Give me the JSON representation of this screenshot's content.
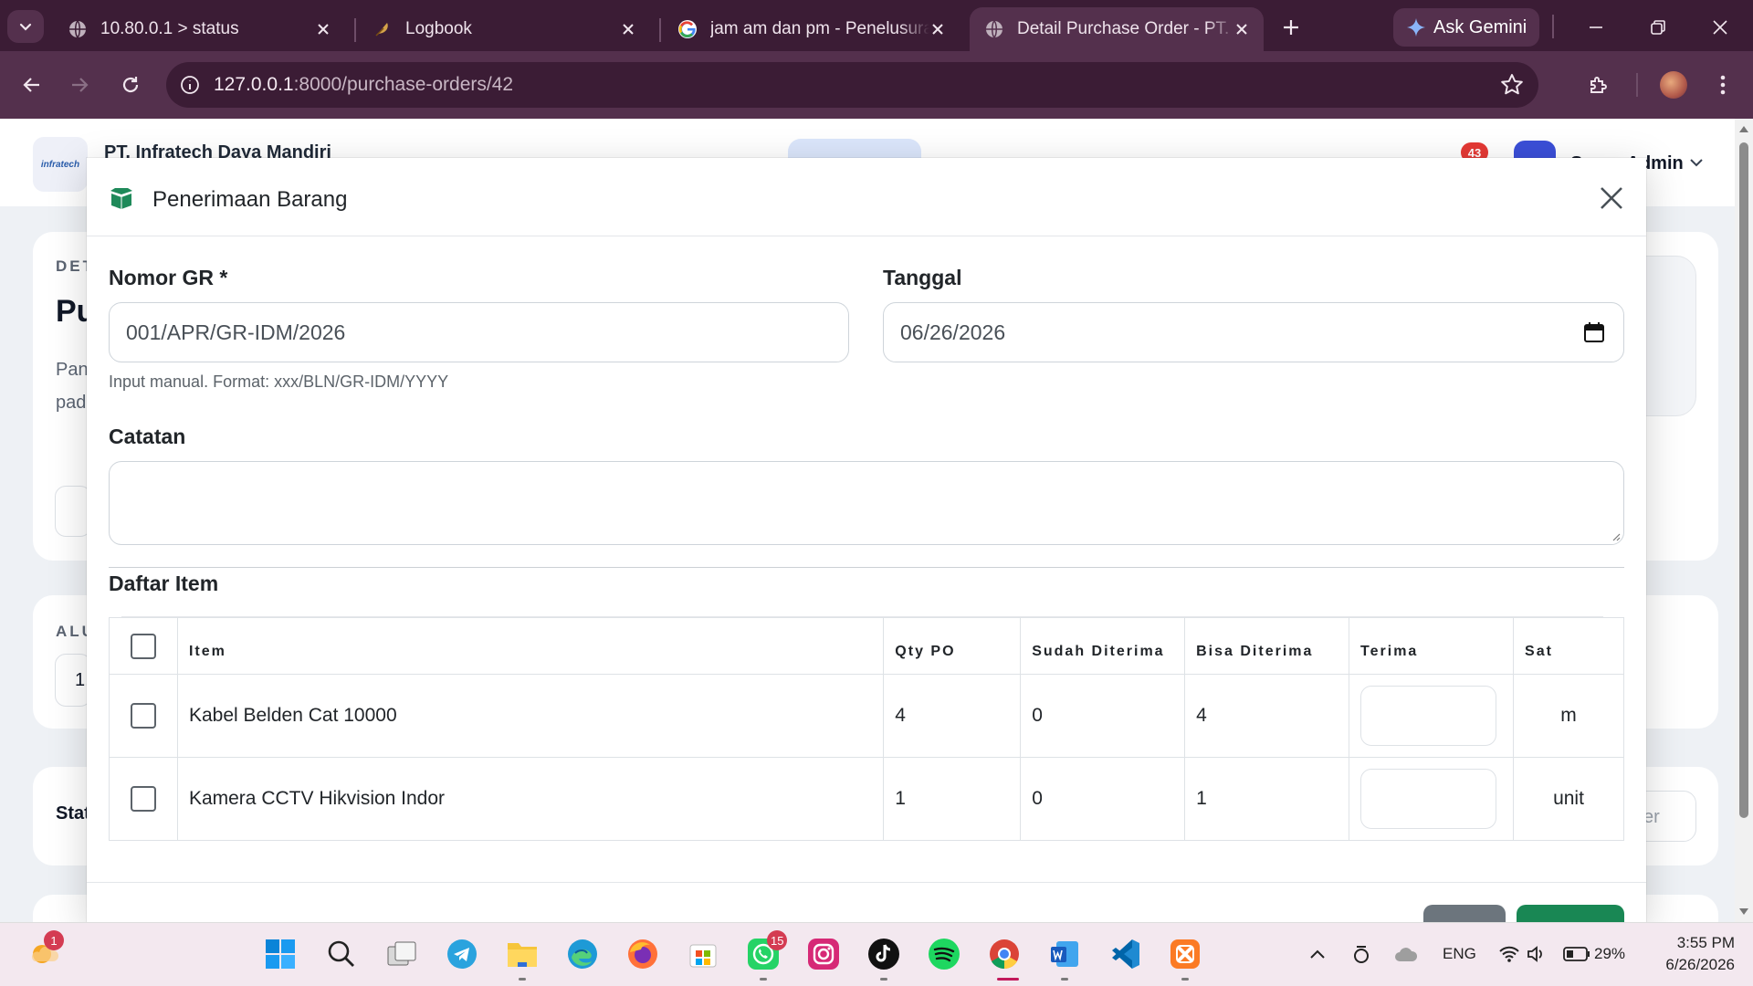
{
  "browser": {
    "tabs": [
      {
        "title": "10.80.0.1 > status",
        "active": false
      },
      {
        "title": "Logbook",
        "active": false
      },
      {
        "title": "jam am dan pm - Penelusuran Google",
        "active": false
      },
      {
        "title": "Detail Purchase Order - PT. Infratech Daya Mandiri",
        "active": true
      }
    ],
    "gemini_label": "Ask Gemini",
    "url_host": "127.0.0.1",
    "url_path": ":8000/purchase-orders/42"
  },
  "app": {
    "company": "PT. Infratech Daya Mandiri",
    "logo_text": "infratech",
    "notification_count": "43",
    "user": "Super Admin"
  },
  "background": {
    "section_label": "DET",
    "heading_fragment": "Pu",
    "desc_line1": "Pan",
    "desc_line2": "pad",
    "alur_label": "ALU",
    "value_fragment": "1.",
    "status_label": "Stat",
    "right_fragment": "er"
  },
  "modal": {
    "title": "Penerimaan Barang",
    "nomor_gr_label": "Nomor GR *",
    "nomor_gr_value": "001/APR/GR-IDM/2026",
    "nomor_gr_help": "Input manual. Format: xxx/BLN/GR-IDM/YYYY",
    "tanggal_label": "Tanggal",
    "tanggal_value": "06/26/2026",
    "catatan_label": "Catatan",
    "catatan_value": "",
    "daftar_item_label": "Daftar Item",
    "table": {
      "headers": [
        "Item",
        "Qty PO",
        "Sudah Diterima",
        "Bisa Diterima",
        "Terima",
        "Sat"
      ],
      "rows": [
        {
          "item": "Kabel Belden Cat 10000",
          "qty_po": "4",
          "sudah_diterima": "0",
          "bisa_diterima": "4",
          "terima": "",
          "sat": "m"
        },
        {
          "item": "Kamera CCTV Hikvision Indor",
          "qty_po": "1",
          "sudah_diterima": "0",
          "bisa_diterima": "1",
          "terima": "",
          "sat": "unit"
        }
      ]
    }
  },
  "taskbar": {
    "whatsapp_badge": "15",
    "weather_badge": "1",
    "language": "ENG",
    "battery": "29%",
    "time": "3:55 PM",
    "date": "6/26/2026"
  },
  "colors": {
    "chrome_dark": "#3b1c35",
    "chrome_mid": "#54304d",
    "modal_icon_green": "#1f8a5a",
    "primary_green": "#198754",
    "secondary_gray": "#6c757d",
    "badge_red": "#e53935"
  }
}
